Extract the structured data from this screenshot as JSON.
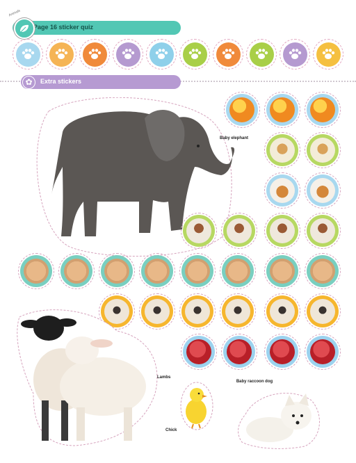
{
  "header": {
    "small_text": "Animals",
    "title": "Page 16 sticker quiz"
  },
  "paw_stickers": [
    {
      "icon": "paw-icon",
      "bg": "#a8d8ef"
    },
    {
      "icon": "paw-icon",
      "bg": "#f5b455"
    },
    {
      "icon": "paw-icon",
      "bg": "#f08a3b"
    },
    {
      "icon": "paw-icon",
      "bg": "#b59ad0"
    },
    {
      "icon": "paw-icon",
      "bg": "#8fd0ea"
    },
    {
      "icon": "paw-icon",
      "bg": "#a9cf48"
    },
    {
      "icon": "paw-icon",
      "bg": "#f08a3b"
    },
    {
      "icon": "paw-icon",
      "bg": "#a9cf48"
    },
    {
      "icon": "paw-icon",
      "bg": "#b59ad0"
    },
    {
      "icon": "paw-icon",
      "bg": "#f5c040"
    }
  ],
  "extra_section": {
    "title": "Extra stickers",
    "icon": "star-icon"
  },
  "labels": {
    "elephant": "Baby elephant",
    "lambs": "Lambs",
    "chick": "Chick",
    "raccoon_dog": "Baby raccoon dog"
  },
  "colors": {
    "teal": "#52c7b4",
    "purple": "#b69ad2",
    "cut_line": "#d6a3bd"
  }
}
